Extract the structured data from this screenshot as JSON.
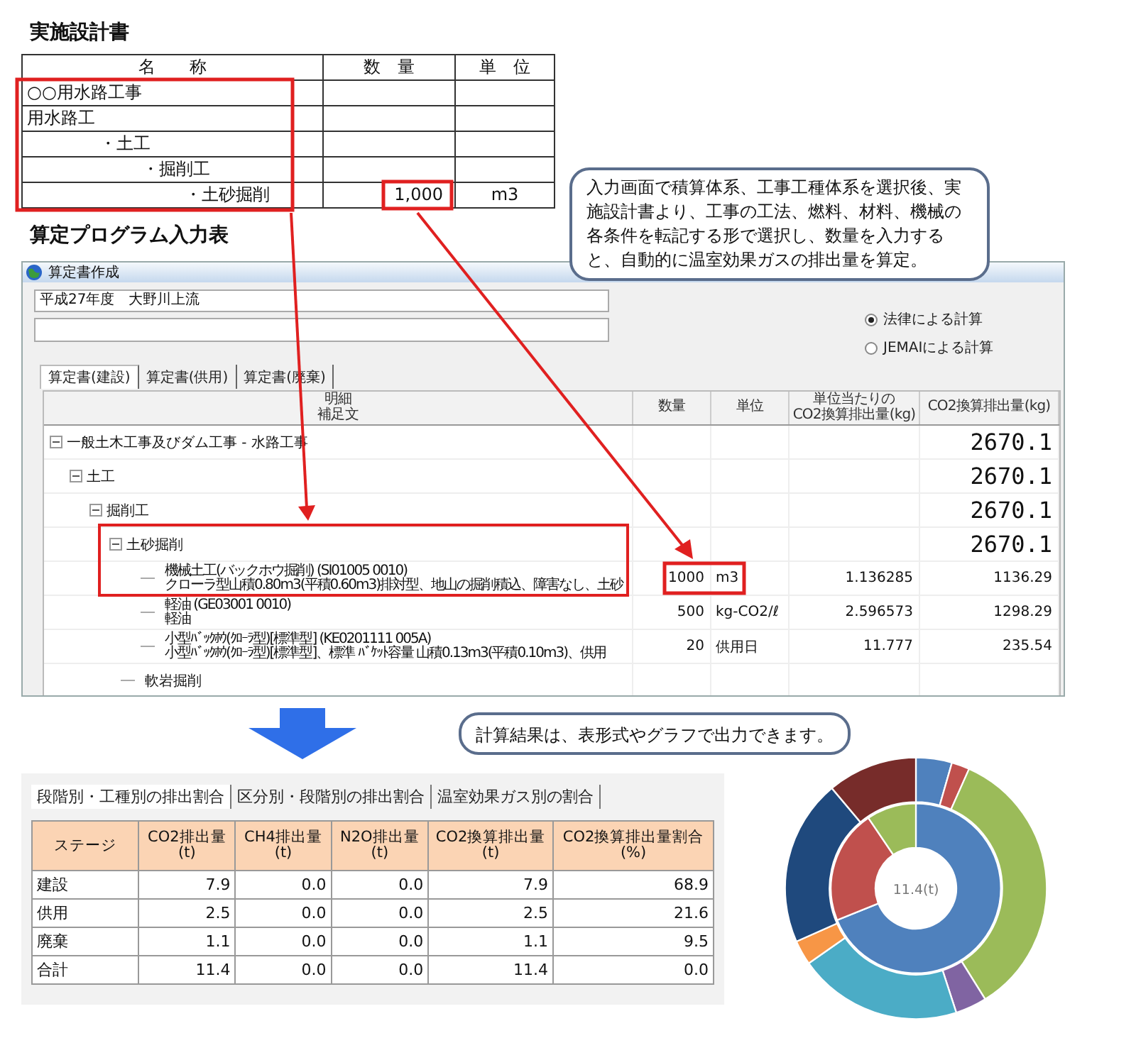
{
  "design_doc": {
    "title": "実施設計書",
    "columns": [
      "名　　称",
      "数　量",
      "単　位"
    ],
    "rows": [
      {
        "name": "○○用水路工事"
      },
      {
        "name": "用水路工",
        "children": [
          {
            "name": "・土工",
            "children": [
              {
                "name": "・掘削工",
                "children": [
                  {
                    "name": "・土砂掘削",
                    "quantity": "1,000",
                    "unit": "m3"
                  }
                ]
              }
            ]
          }
        ]
      }
    ]
  },
  "callouts": [
    {
      "text": "入力画面で積算体系、工事工種体系を選択後、実施設計書より、工事の工法、燃料、材料、機械の各条件を転記する形で選択し、数量を入力すると、自動的に温室効果ガスの排出量を算定。"
    },
    {
      "text": "計算結果は、表形式やグラフで出力できます。"
    }
  ],
  "program_heading": "算定プログラム入力表",
  "app_window": {
    "title": "算定書作成",
    "project_field": {
      "value": "平成27年度　大野川上流"
    },
    "calc_methods": [
      {
        "label": "法律による計算",
        "selected": true
      },
      {
        "label": "JEMAIによる計算",
        "selected": false
      }
    ],
    "tabs": [
      {
        "label": "算定書(建設)",
        "selected": true
      },
      {
        "label": "算定書(供用)",
        "selected": false
      },
      {
        "label": "算定書(廃棄)",
        "selected": false
      }
    ],
    "grid": {
      "columns": [
        {
          "lines": [
            "明細",
            "補足文"
          ]
        },
        {
          "lines": [
            "数量"
          ]
        },
        {
          "lines": [
            "単位"
          ]
        },
        {
          "lines": [
            "単位当たりの",
            "CO2換算排出量(kg)"
          ]
        },
        {
          "lines": [
            "CO2換算排出量(kg)"
          ]
        }
      ],
      "rows": [
        {
          "kind": "group",
          "label": "一般土木工事及びダム工事 - 水路工事",
          "total": "2670.1",
          "expanded": true,
          "children": [
            {
              "kind": "group",
              "label": "土工",
              "total": "2670.1",
              "expanded": true,
              "children": [
                {
                  "kind": "group",
                  "label": "掘削工",
                  "total": "2670.1",
                  "expanded": true,
                  "children": [
                    {
                      "kind": "group",
                      "label": "土砂掘削",
                      "total": "2670.1",
                      "expanded": true,
                      "children": [
                        {
                          "kind": "item",
                          "lines": [
                            "機械土工(バックホウ掘削) (SI01005 0010)",
                            "クローラ型山積0.80m3(平積0.60m3)排対型、地山の掘削積込、障害なし、土砂"
                          ],
                          "quantity": "1000",
                          "unit": "m3",
                          "unit_co2": "1.136285",
                          "co2": "1136.29"
                        },
                        {
                          "kind": "item",
                          "lines": [
                            "軽油 (GE03001 0010)",
                            "軽油"
                          ],
                          "quantity": "500",
                          "unit": "kg-CO2/ℓ",
                          "unit_co2": "2.596573",
                          "co2": "1298.29"
                        },
                        {
                          "kind": "item",
                          "lines": [
                            "小型ﾊﾞｯｸﾎｳ(ｸﾛｰﾗ型)[標準型] (KE0201111 005A)",
                            "小型ﾊﾞｯｸﾎｳ(ｸﾛｰﾗ型)[標準型]、標準 ﾊﾞｹｯﾄ容量 山積0.13m3(平積0.10m3)、供用"
                          ],
                          "quantity": "20",
                          "unit": "供用日",
                          "unit_co2": "11.777",
                          "co2": "235.54"
                        }
                      ]
                    },
                    {
                      "kind": "label",
                      "label": "軟岩掘削"
                    }
                  ]
                }
              ]
            }
          ]
        }
      ]
    }
  },
  "results": {
    "tabs": [
      {
        "label": "段階別・工種別の排出割合",
        "selected": true
      },
      {
        "label": "区分別・段階別の排出割合",
        "selected": false
      },
      {
        "label": "温室効果ガス別の割合",
        "selected": false
      }
    ],
    "table": {
      "columns": [
        "ステージ",
        "CO2排出量(t)",
        "CH4排出量(t)",
        "N2O排出量(t)",
        "CO2換算排出量(t)",
        "CO2換算排出量割合(%)"
      ],
      "rows": [
        [
          "建設",
          "7.9",
          "0.0",
          "0.0",
          "7.9",
          "68.9"
        ],
        [
          "供用",
          "2.5",
          "0.0",
          "0.0",
          "2.5",
          "21.6"
        ],
        [
          "廃棄",
          "1.1",
          "0.0",
          "0.0",
          "1.1",
          "9.5"
        ],
        [
          "合計",
          "11.4",
          "0.0",
          "0.0",
          "11.4",
          "0.0"
        ]
      ]
    },
    "donut": {
      "center_label": "11.4(t)"
    }
  }
}
